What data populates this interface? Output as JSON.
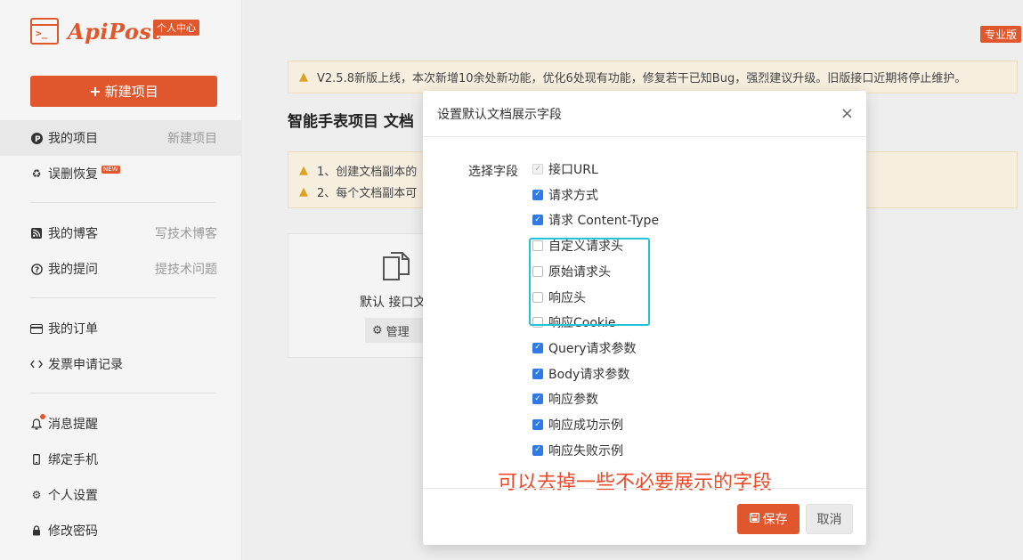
{
  "sidebar": {
    "logo_text": "ApiPost",
    "logo_badge": "个人中心",
    "new_project_label": "新建项目",
    "items": [
      {
        "label": "我的项目",
        "side": "新建项目",
        "icon": "circle-p-icon"
      },
      {
        "label": "误删恢复",
        "side": "",
        "icon": "recycle-icon",
        "tag": "NEW"
      },
      {
        "label": "我的博客",
        "side": "写技术博客",
        "icon": "rss-icon"
      },
      {
        "label": "我的提问",
        "side": "提技术问题",
        "icon": "question-icon"
      },
      {
        "label": "我的订单",
        "side": "",
        "icon": "credit-card-icon"
      },
      {
        "label": "发票申请记录",
        "side": "",
        "icon": "code-icon"
      },
      {
        "label": "消息提醒",
        "side": "",
        "icon": "bell-icon"
      },
      {
        "label": "绑定手机",
        "side": "",
        "icon": "phone-icon"
      },
      {
        "label": "个人设置",
        "side": "",
        "icon": "gear-icon"
      },
      {
        "label": "修改密码",
        "side": "",
        "icon": "lock-icon"
      }
    ]
  },
  "main": {
    "pro_badge": "专业版",
    "notice": "V2.5.8新版上线，本次新增10余处新功能，优化6处现有功能，修复若干已知Bug，强烈建议升级。旧版接口近期将停止维护。",
    "page_title": "智能手表项目 文档",
    "tips": [
      "1、创建文档副本的",
      "2、每个文档副本可"
    ],
    "doc_card_label": "默认 接口文",
    "manage_label": "管理"
  },
  "modal": {
    "title": "设置默认文档展示字段",
    "field_label": "选择字段",
    "fields": [
      {
        "label": "接口URL",
        "state": "disabled"
      },
      {
        "label": "请求方式",
        "state": "checked"
      },
      {
        "label": "请求 Content-Type",
        "state": "checked"
      },
      {
        "label": "自定义请求头",
        "state": "unchecked"
      },
      {
        "label": "原始请求头",
        "state": "unchecked"
      },
      {
        "label": "响应头",
        "state": "unchecked"
      },
      {
        "label": "响应Cookie",
        "state": "unchecked"
      },
      {
        "label": "Query请求参数",
        "state": "checked"
      },
      {
        "label": "Body请求参数",
        "state": "checked"
      },
      {
        "label": "响应参数",
        "state": "checked"
      },
      {
        "label": "响应成功示例",
        "state": "checked"
      },
      {
        "label": "响应失败示例",
        "state": "checked"
      }
    ],
    "annotation": "可以去掉一些不必要展示的字段",
    "save_label": "保存",
    "cancel_label": "取消"
  },
  "colors": {
    "brand": "#e0572d",
    "checkbox": "#2f7ae5",
    "highlight": "#23c3d8",
    "annotation": "#ec4a2a"
  }
}
